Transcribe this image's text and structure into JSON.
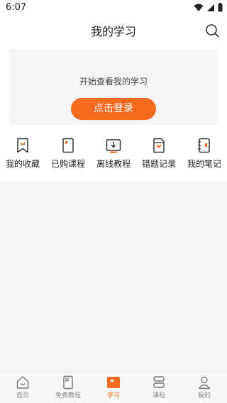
{
  "status_bar": {
    "time": "6:07"
  },
  "header": {
    "title": "我的学习"
  },
  "login_card": {
    "prompt": "开始查看我的学习",
    "button_label": "点击登录"
  },
  "shortcuts": [
    {
      "label": "我的收藏",
      "icon": "bookmark-icon"
    },
    {
      "label": "已购课程",
      "icon": "purchased-course-icon"
    },
    {
      "label": "离线教程",
      "icon": "download-icon"
    },
    {
      "label": "错题记录",
      "icon": "wrong-answers-icon"
    },
    {
      "label": "我的笔记",
      "icon": "notebook-icon"
    }
  ],
  "tabbar": {
    "items": [
      {
        "label": "首页",
        "icon": "home-icon"
      },
      {
        "label": "免费教程",
        "icon": "book-icon"
      },
      {
        "label": "学习",
        "icon": "study-icon",
        "active": true
      },
      {
        "label": "课程",
        "icon": "course-icon"
      },
      {
        "label": "我的",
        "icon": "profile-icon"
      }
    ]
  },
  "colors": {
    "accent": "#f46a1f",
    "background": "#f4f4f4",
    "card": "#f5f5f5"
  }
}
